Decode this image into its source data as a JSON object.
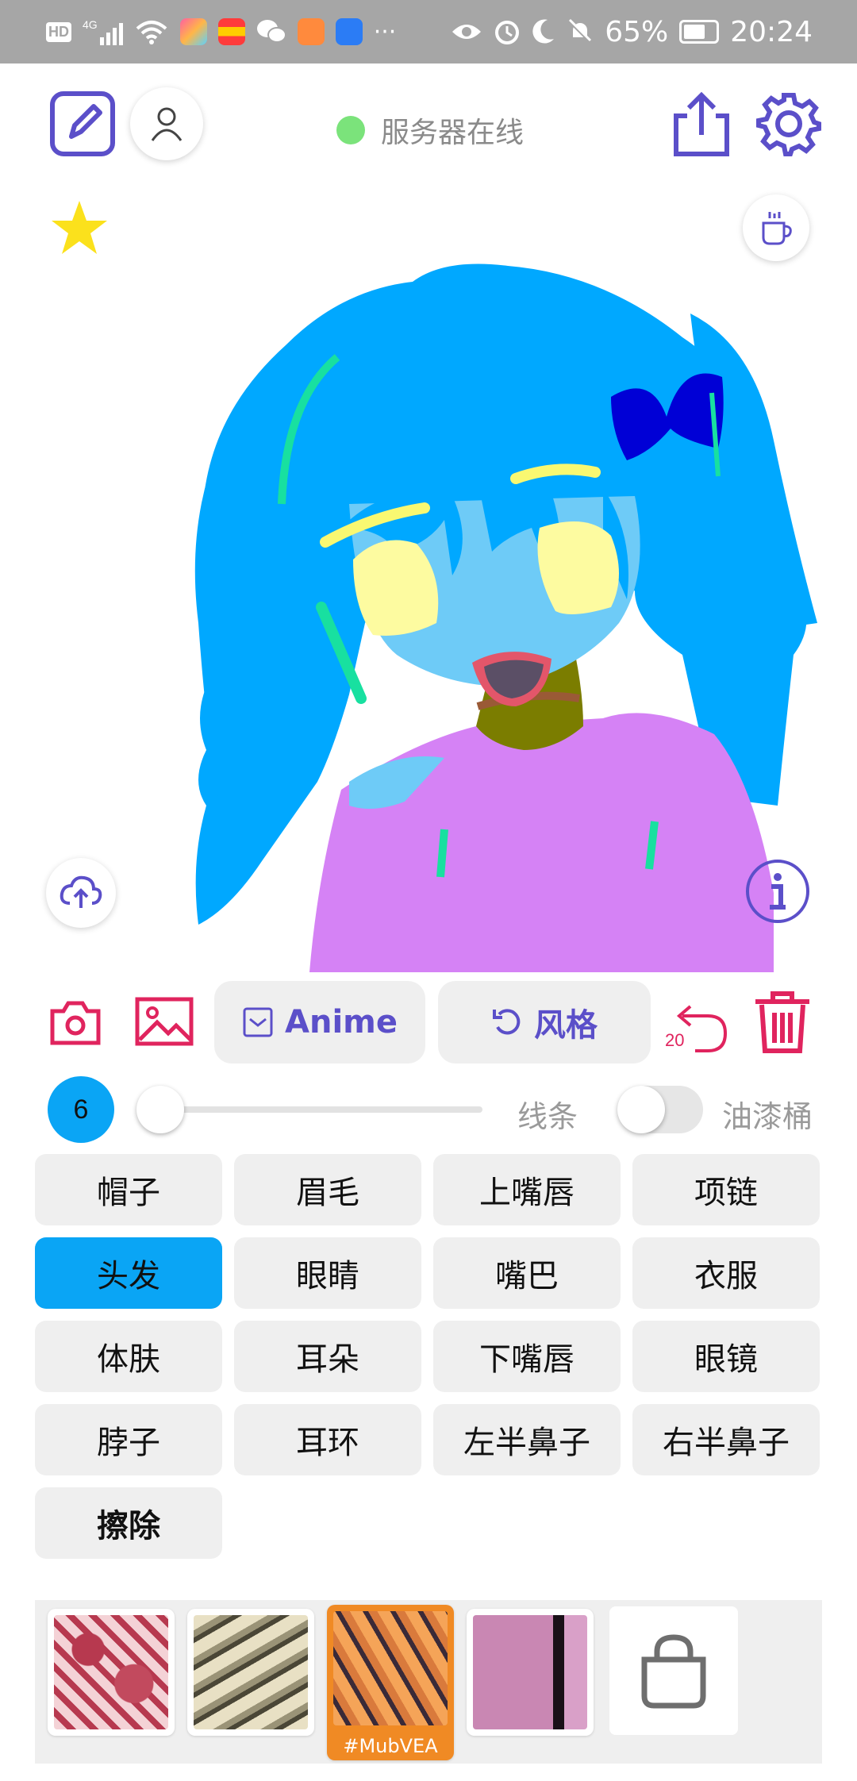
{
  "status_bar": {
    "network_badges": [
      "HD",
      "4G"
    ],
    "battery": "65%",
    "time": "20:24",
    "overflow": "···"
  },
  "header": {
    "server_status": "服务器在线",
    "status_color": "#7be37b"
  },
  "toolbar": {
    "anime_label": "Anime",
    "style_label": "风格",
    "undo_count": "20"
  },
  "brush": {
    "size": "6",
    "line_label": "线条",
    "bucket_label": "油漆桶"
  },
  "parts": [
    {
      "label": "帽子",
      "active": false
    },
    {
      "label": "眉毛",
      "active": false
    },
    {
      "label": "上嘴唇",
      "active": false
    },
    {
      "label": "项链",
      "active": false
    },
    {
      "label": "头发",
      "active": true
    },
    {
      "label": "眼睛",
      "active": false
    },
    {
      "label": "嘴巴",
      "active": false
    },
    {
      "label": "衣服",
      "active": false
    },
    {
      "label": "体肤",
      "active": false
    },
    {
      "label": "耳朵",
      "active": false
    },
    {
      "label": "下嘴唇",
      "active": false
    },
    {
      "label": "眼镜",
      "active": false
    },
    {
      "label": "脖子",
      "active": false
    },
    {
      "label": "耳环",
      "active": false
    },
    {
      "label": "左半鼻子",
      "active": false
    },
    {
      "label": "右半鼻子",
      "active": false
    },
    {
      "label": "擦除",
      "active": false
    }
  ],
  "styles": {
    "selected_tag": "#MubVEA"
  },
  "colors": {
    "accent": "#5b4fc9",
    "active_part": "#0aa5f5",
    "danger": "#e0245e",
    "selected_style": "#f08a24"
  }
}
